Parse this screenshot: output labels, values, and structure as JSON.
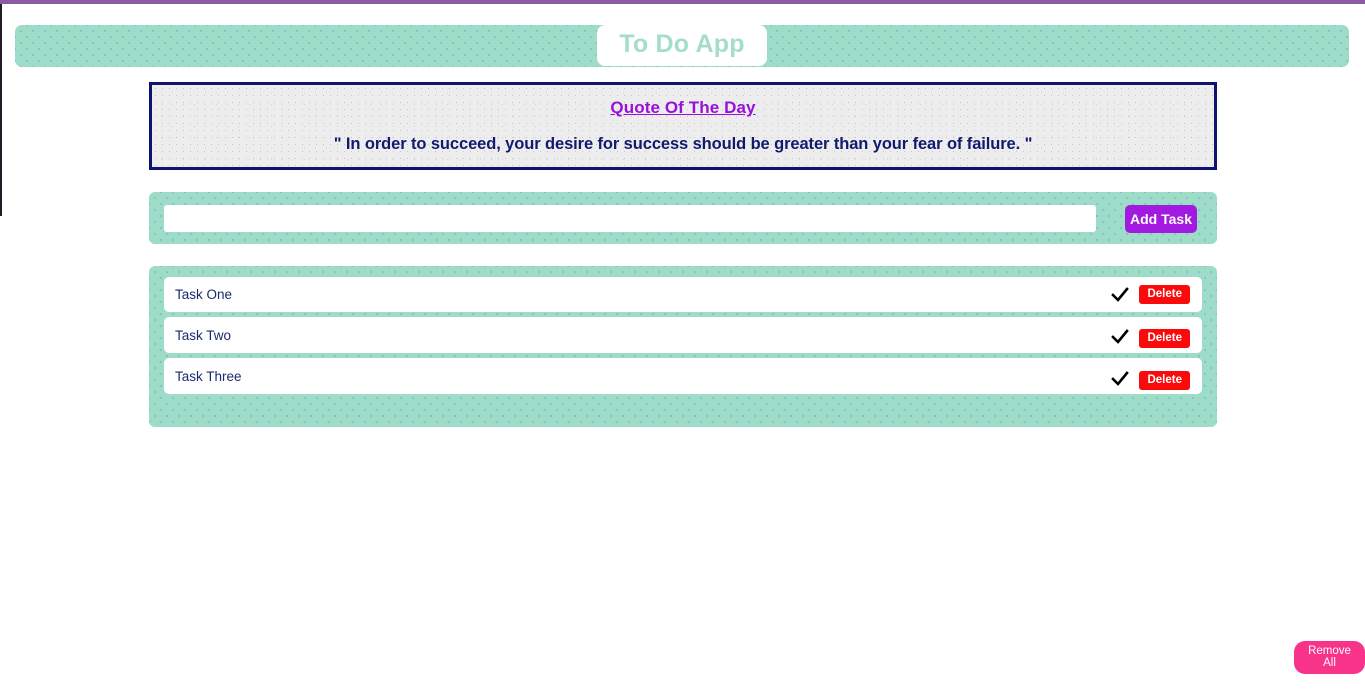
{
  "browser": {
    "top_strip_color": "#8b5aa0"
  },
  "header": {
    "title": "To Do App",
    "background_color": "#9edcc7",
    "title_color": "#a5ddcb"
  },
  "quote": {
    "heading": "Quote Of The Day",
    "text": "\" In order to succeed, your desire for success should be greater than your fear of failure. \"",
    "heading_color": "#9810d9",
    "text_color": "#101a6e",
    "border_color": "#0d1470"
  },
  "add_task": {
    "input_value": "",
    "input_placeholder": "",
    "button_label": "Add Task",
    "button_color": "#a21ae0"
  },
  "tasks": {
    "items": [
      {
        "label": "Task One",
        "check_icon": "check-icon",
        "delete_label": "Delete"
      },
      {
        "label": "Task Two",
        "check_icon": "check-icon",
        "delete_label": "Delete"
      },
      {
        "label": "Task Three",
        "check_icon": "check-icon",
        "delete_label": "Delete"
      }
    ],
    "delete_color": "#fa0a0a"
  },
  "footer": {
    "remove_all_label": "Remove All",
    "remove_all_color": "#f8338a"
  }
}
